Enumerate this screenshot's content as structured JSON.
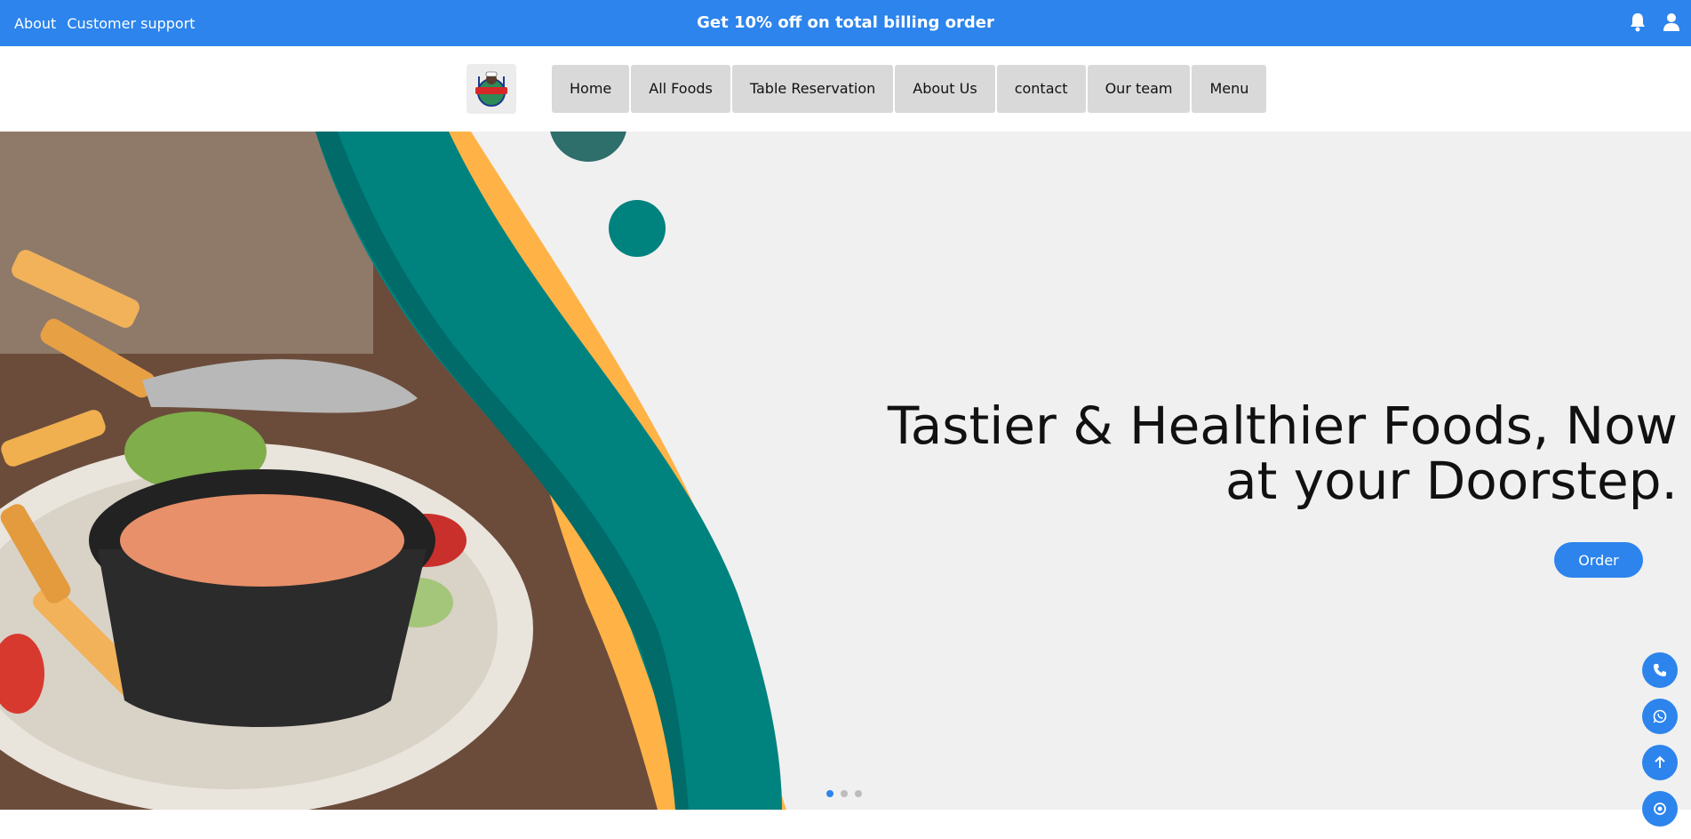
{
  "topbar": {
    "links": [
      "About",
      "Customer support"
    ],
    "promo": "Get 10% off on total billing order",
    "icons": [
      "bell-icon",
      "user-icon"
    ]
  },
  "navbar": {
    "logo": "restaurant-logo",
    "items": [
      "Home",
      "All Foods",
      "Table Reservation",
      "About Us",
      "contact",
      "Our team",
      "Menu"
    ]
  },
  "hero": {
    "headline_line1": "Tastier & Healthier Foods, Now",
    "headline_line2": "at your Doorstep.",
    "order_label": "Order",
    "slides": 3,
    "active_slide": 1
  },
  "floating_buttons": [
    "phone-icon",
    "whatsapp-icon",
    "arrow-up-icon",
    "chat-icon"
  ],
  "colors": {
    "accent": "#2c84ec",
    "teal": "#00827f",
    "orange": "#ffb347",
    "hero_bg": "#f0f0f0",
    "nav_button": "#d9d9d9"
  }
}
